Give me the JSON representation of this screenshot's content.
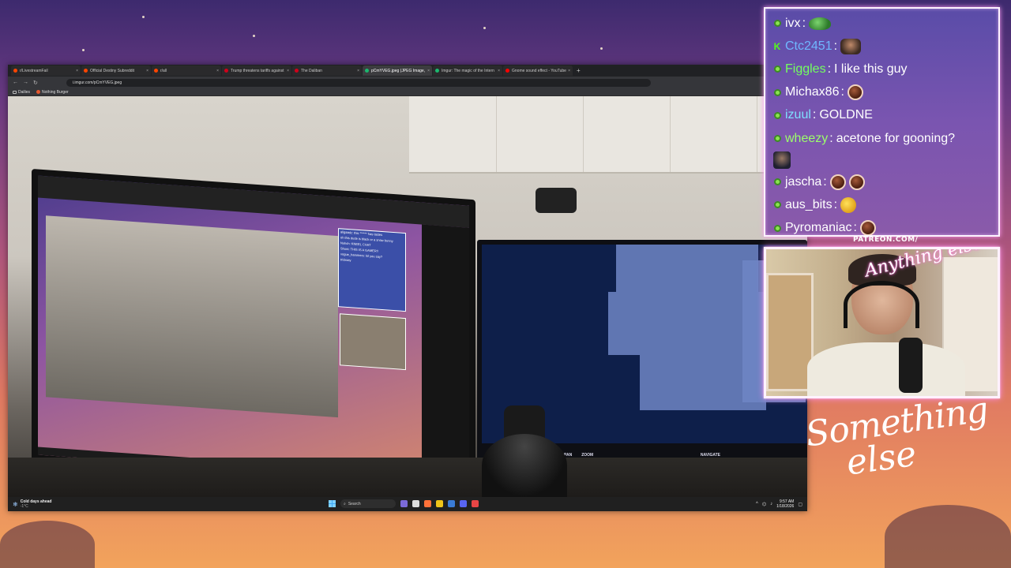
{
  "browser": {
    "tabs": [
      {
        "label": "r/LivestreamFail",
        "color": "#ff4500",
        "active": false
      },
      {
        "label": "Official Destiny Subreddit",
        "color": "#ff4500",
        "active": false
      },
      {
        "label": "r/all",
        "color": "#ff4500",
        "active": false
      },
      {
        "label": "Trump threatens tariffs against",
        "color": "#d0021b",
        "active": false
      },
      {
        "label": "The Daliban",
        "color": "#d0021b",
        "active": false
      },
      {
        "label": "pCmYVEG.jpeg (JPEG Image, 40",
        "color": "#1bb76e",
        "active": true
      },
      {
        "label": "Imgur: The magic of the Intern",
        "color": "#1bb76e",
        "active": false
      },
      {
        "label": "Gnome sound effect - YouTube",
        "color": "#ff0000",
        "active": false
      }
    ],
    "new_tab_label": "+",
    "url": "i.imgur.com/pCmYVEG.jpeg",
    "bookmarks": [
      {
        "label": "Dailies",
        "icon": "folder-icon"
      },
      {
        "label": "Nothing Burger",
        "icon": "site-icon"
      }
    ]
  },
  "photo": {
    "left_monitor_chat": [
      "aligaadz: this ****** has tastes",
      "oh this dude is black or a snow bunny",
      "Nuhch: KNEEL CHAT",
      "Shunt: THIS IS A GAMER!!",
      "vogue_hammers: lol you say?",
      "tricksey"
    ],
    "map_hints": [
      "PAN",
      "ZOOM"
    ],
    "map_hint_right": "NAVIGATE"
  },
  "taskbar": {
    "weather_title": "Cold days ahead",
    "weather_temp": "-1°C",
    "search_placeholder": "Search",
    "time": "9:57 AM",
    "date": "1/18/2026"
  },
  "chat": {
    "messages": [
      {
        "user": "ivx",
        "color": "#ffffff",
        "badge": "dot",
        "text": "",
        "emotes": [
          "frog"
        ]
      },
      {
        "user": "Ctc2451",
        "color": "#6fb7ff",
        "badge": "k",
        "text": "",
        "emotes": [
          "face"
        ]
      },
      {
        "user": "Figgles",
        "color": "#74ff5e",
        "badge": "dot",
        "text": "I like this guy",
        "emotes": []
      },
      {
        "user": "Michax86",
        "color": "#ffffff",
        "badge": "dot",
        "text": "",
        "emotes": [
          "bean"
        ]
      },
      {
        "user": "izuul",
        "color": "#7fe0ff",
        "badge": "dot",
        "text": "GOLDNE",
        "emotes": []
      },
      {
        "user": "wheezy",
        "color": "#9cff6a",
        "badge": "dot",
        "text": "acetone for gooning?",
        "emotes": []
      },
      {
        "user": "jascha",
        "color": "#ffffff",
        "badge": "dot",
        "text": "",
        "emotes": [
          "bean",
          "bean"
        ]
      },
      {
        "user": "aus_bits",
        "color": "#ffffff",
        "badge": "dot",
        "text": "",
        "emotes": [
          "duck"
        ]
      },
      {
        "user": "Pyromaniac",
        "color": "#ffffff",
        "badge": "dot",
        "text": "",
        "emotes": [
          "bean"
        ]
      }
    ]
  },
  "webcam": {
    "label": "PATREON.COM/",
    "script_text": "Anything else?"
  },
  "logo": {
    "line1": "Something",
    "line2": "else"
  }
}
